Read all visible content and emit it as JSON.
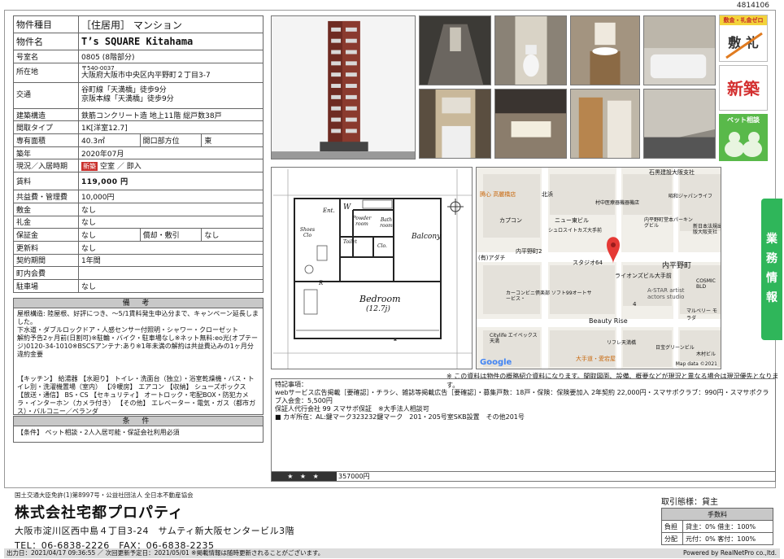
{
  "doc_id": "4814106",
  "spec": {
    "type_label": "物件種目",
    "type_value": "［住居用］ マンション",
    "name_label": "物件名",
    "name_value": "T’s SQUARE Kitahama",
    "room_label": "号室名",
    "room_value": "0805 (8階部分)",
    "addr_label": "所在地",
    "postal": "〒540-0037",
    "addr_value": "大阪府大阪市中央区内平野町２丁目3-7",
    "traffic_label": "交通",
    "traffic_1": "谷町線「天満橋」徒歩9分",
    "traffic_2": "京阪本線「天満橋」徒歩9分",
    "struct_label": "建築構造",
    "struct_value": "鉄筋コンクリート造 地上11階 総戸数38戸",
    "layout_label": "間取タイプ",
    "layout_value": "1K[洋室12.7]",
    "area_label": "専有面積",
    "area_value": "40.3㎡",
    "dir_label": "開口部方位",
    "dir_value": "東",
    "built_label": "築年",
    "built_value": "2020年07月",
    "status_label": "現況／入居時期",
    "new_tag": "新築",
    "status_value": "空室 ／ 即入",
    "rent_label": "賃料",
    "rent_value": "119,000 円",
    "fee_label": "共益費・管理費",
    "fee_value": "10,000円",
    "deposit_label": "敷金",
    "deposit_value": "なし",
    "key_label": "礼金",
    "key_value": "なし",
    "guarantee_label": "保証金",
    "guarantee_value": "なし",
    "amort_label": "償却・敷引",
    "amort_value": "なし",
    "renew_label": "更新料",
    "renew_value": "なし",
    "contract_label": "契約期間",
    "contract_value": "1年間",
    "town_label": "町内会費",
    "town_value": "",
    "parking_label": "駐車場",
    "parking_value": "なし"
  },
  "bikou": {
    "heading": "備 考",
    "text": "屋根構造: 陸屋根、好評につき、～5/1賃料発生申込分まで、キャンペーン延長しました。\n下水道・ダブルロックドア・人感センサー付照明・シャワー・クローゼット\n解約予告2ヶ月前(日割可)※駐輪・バイク・駐車場なし※ネット無料:eo光(オプテージ)0120-34-1010※BSCSアンテナ:あり※1年未満の解約は共益費込みの1ヶ月分違約金要\n\n\n【キッチン】 給湯器 【水廻り】 トイレ・洗面台（独立）・浴室乾燥機・バス・トイレ別・洗濯機置場（室内） 【冷暖房】 エアコン 【収納】 シューズボックス 【放送・通信】 BS・CS 【セキュリティ】 オートロック・宅配BOX・防犯カメラ・インターホン（カメラ付き） 【その他】 エレベーター・電気・ガス（都市ガス）・バルコニー／ベランダ"
  },
  "conditions": {
    "heading": "条 件",
    "text": "【条件】 ペット相談・2人入居可能・保証会社利用必須"
  },
  "floorplan": {
    "rooms": [
      "Ent.",
      "W",
      "Powder room",
      "Bath room",
      "Shoes Clo",
      "Toilet",
      "Clo.",
      "Balcony",
      "Bedroom",
      "(12.7j)",
      "R"
    ]
  },
  "map": {
    "labels": [
      "石黒建設大阪支社",
      "腾心 高麗橋店",
      "北浜",
      "村中医療器機器機店",
      "昭和ジャパンライフ",
      "ニュー東ビル",
      "カプコン",
      "シュロスイトカズ大手前",
      "内平野町堂本パーキングビル",
      "新日本法規出版大阪支社",
      "内平野町2",
      "(有)アダチ",
      "スタジオ64",
      "内平野町",
      "ライオンズビル大手前",
      "COSMIC BLD",
      "A-STAR artist actors studio",
      "カーコンビニ倶楽部 ソフト99オートサービス・",
      "マルベリー モラダ",
      "Beauty Rise",
      "4",
      "Citylife エイペックス天満",
      "リフレ天満橋",
      "日宝グリーンビル",
      "木村ビル",
      "大手道・愛宕屋"
    ],
    "google": "Google",
    "attribution": "Map data ©2021",
    "note": "※ この資料は物件の概略紹介資料になります。間取図面、設備、概要などが現況と異なる場合は現況優先となります。"
  },
  "remarks": {
    "heading": "特記事項：",
    "text": "webサービス広告掲載［要確認］・チラシ、雑誌等掲載広告［要確認］・募集戸数：18戸・保険：保険要加入 2年契約 22,000円・スマサポクラブ：990円・スマサポクラブ入会金：5,500円\n保証人代行会社 99 スマサポ保証　※大手法人相談可\n■ カギ所在：AL:鍵マーク323232鍵マーク　201・205号室SKB設置　その他201号",
    "stars": "★ ★ ★",
    "price2": "357000円"
  },
  "badges": {
    "zero_label": "敷金・礼金ゼロ",
    "zero_sub": "敷 礼",
    "new_label": "新築",
    "pet_label": "ペット相談"
  },
  "side_tab": [
    "業",
    "務",
    "情",
    "報"
  ],
  "company": {
    "license": "国土交通大臣免許(1)第8997号・公益社団法人 全日本不動産協会",
    "name": "株式会社宅都プロパティ",
    "address": "大阪市淀川区西中島４丁目3-24　サムティ新大阪センタービル3階",
    "tel": "TEL：06-6838-2226　FAX：06-6838-2235"
  },
  "fee": {
    "title": "取引態様：貸主",
    "header": "手数料",
    "row1_label": "負担",
    "row1_value": "貸主：0% 借主：100%",
    "row2_label": "分配",
    "row2_value": "元付：0% 客付：100%"
  },
  "footer": {
    "text": "出力日：2021/04/17 09:36:55 ／ 次回更新予定日：2021/05/01 ※掲載情報は随時更新されることがございます。",
    "powered": "Powered by RealNetPro co.,ltd."
  }
}
